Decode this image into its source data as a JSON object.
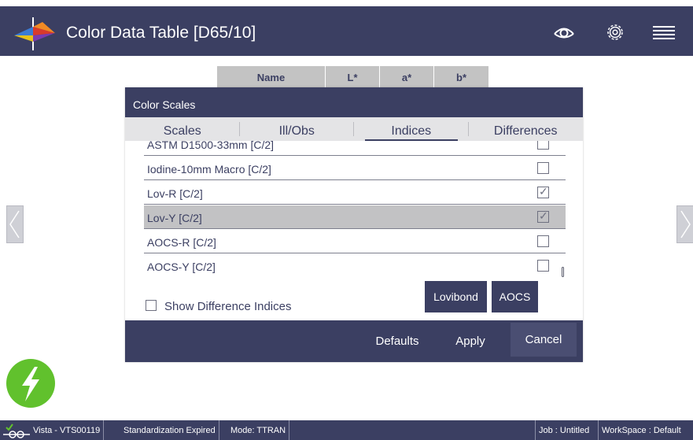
{
  "header": {
    "title": "Color Data Table [D65/10]",
    "logo_icon": "prism-spectrum-logo-icon",
    "icons": [
      "eye-icon",
      "gear-icon",
      "menu-icon"
    ]
  },
  "table": {
    "columns": [
      "Name",
      "L*",
      "a*",
      "b*"
    ]
  },
  "dialog": {
    "title": "Color Scales",
    "tabs": [
      {
        "label": "Scales",
        "active": false
      },
      {
        "label": "Ill/Obs",
        "active": false
      },
      {
        "label": "Indices",
        "active": true
      },
      {
        "label": "Differences",
        "active": false
      }
    ],
    "rows": [
      {
        "label": "ASTM D1500-33mm [C/2]",
        "checked": false,
        "selected": false
      },
      {
        "label": "Iodine-10mm Macro [C/2]",
        "checked": false,
        "selected": false
      },
      {
        "label": "Lov-R [C/2]",
        "checked": true,
        "selected": false
      },
      {
        "label": "Lov-Y [C/2]",
        "checked": true,
        "selected": true
      },
      {
        "label": "AOCS-R [C/2]",
        "checked": false,
        "selected": false
      },
      {
        "label": "AOCS-Y [C/2]",
        "checked": false,
        "selected": false
      }
    ],
    "show_difference_indices": {
      "label": "Show Difference Indices",
      "checked": false
    },
    "preset_buttons": {
      "lovibond": "Lovibond",
      "aocs": "AOCS"
    },
    "footer": {
      "defaults": "Defaults",
      "apply": "Apply",
      "cancel": "Cancel"
    }
  },
  "status_bar": {
    "device": "Vista - VTS00119",
    "standardization": "Standardization Expired",
    "mode": "Mode: TTRAN",
    "job": "Job : Untitled",
    "workspace": "WorkSpace : Default"
  },
  "colors": {
    "primary": "#3b3f62",
    "fab": "#61c12d",
    "selected_row": "#c2c2c4",
    "tab_bar": "#e4e4e6"
  }
}
